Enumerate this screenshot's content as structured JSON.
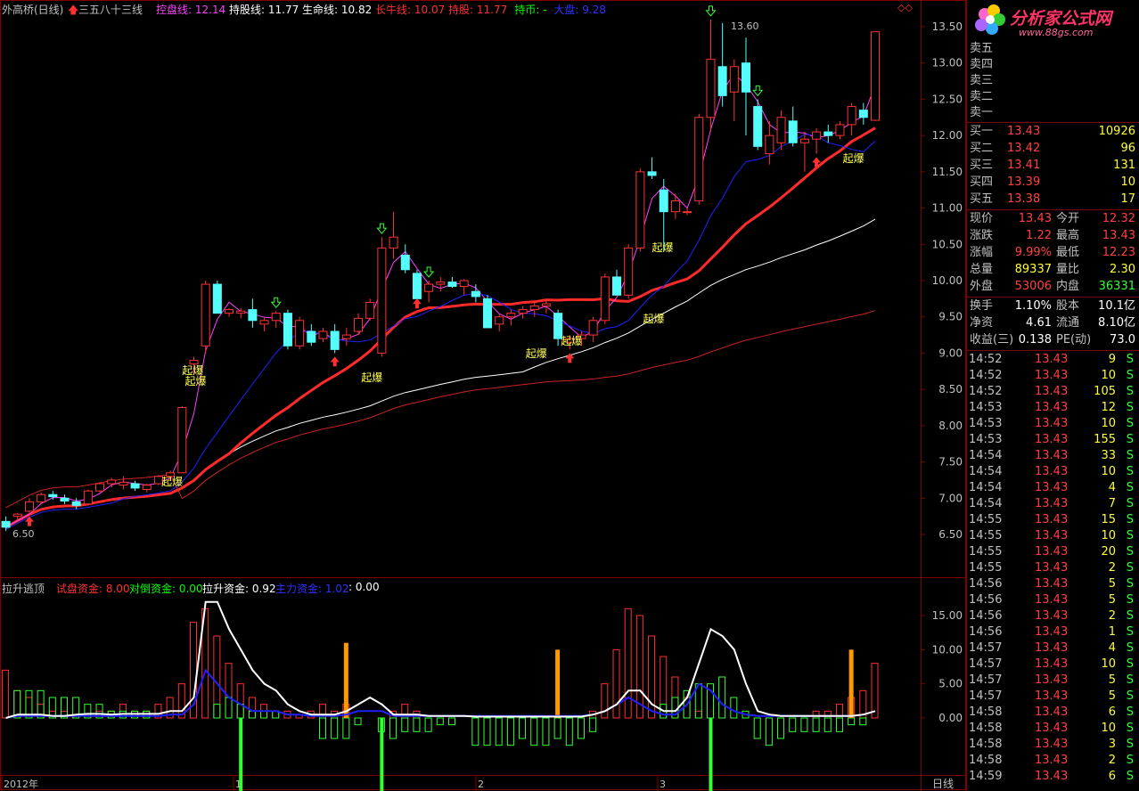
{
  "header": {
    "stock": "外高桥(日线)",
    "formula": "三五八十三线",
    "indicators": [
      {
        "label": "控盘线: 12.14",
        "color": "#ff40ff"
      },
      {
        "label": "持股线: 11.77",
        "color": "#ffffff"
      },
      {
        "label": "生命线: 10.82",
        "color": "#ffffff"
      },
      {
        "label": "长牛线: 10.07",
        "color": "#ff3030"
      },
      {
        "label": "持股: 11.77",
        "color": "#ff3030"
      },
      {
        "label": "持币: -",
        "color": "#00ff00"
      },
      {
        "label": "大盘: 9.28",
        "color": "#3030ff"
      }
    ]
  },
  "sub_header": {
    "title": "拉升逃顶",
    "indicators": [
      {
        "label": "试盘资金: 8.00",
        "color": "#ff3030"
      },
      {
        "label": "对倒资金: 0.00",
        "color": "#00ff00"
      },
      {
        "label": "拉升资金: 0.92",
        "color": "#ffffff"
      },
      {
        "label": "主力资金: 1.02",
        "color": "#3030ff"
      },
      {
        "label": ": 0.00",
        "color": "#ffffff"
      }
    ]
  },
  "logo": {
    "name": "分析家公式网",
    "url_text": "www.88gs.com"
  },
  "price_axis": [
    "13.50",
    "13.00",
    "12.50",
    "12.00",
    "11.50",
    "11.00",
    "10.50",
    "10.00",
    "9.50",
    "9.00",
    "8.50",
    "8.00",
    "7.50",
    "7.00",
    "6.50"
  ],
  "sub_axis": [
    "15.00",
    "10.00",
    "5.00",
    "0.00"
  ],
  "time_axis": [
    "2012年",
    "1",
    "2",
    "3"
  ],
  "period_label": "日线",
  "annotations": {
    "high": "13.60",
    "low": "6.50",
    "signal": "起爆"
  },
  "quote": {
    "sell": [
      {
        "label": "卖五",
        "price": "",
        "vol": ""
      },
      {
        "label": "卖四",
        "price": "",
        "vol": ""
      },
      {
        "label": "卖三",
        "price": "",
        "vol": ""
      },
      {
        "label": "卖二",
        "price": "",
        "vol": ""
      },
      {
        "label": "卖一",
        "price": "",
        "vol": ""
      }
    ],
    "buy": [
      {
        "label": "买一",
        "price": "13.43",
        "vol": "10926"
      },
      {
        "label": "买二",
        "price": "13.42",
        "vol": "96"
      },
      {
        "label": "买三",
        "price": "13.41",
        "vol": "131"
      },
      {
        "label": "买四",
        "price": "13.39",
        "vol": "10"
      },
      {
        "label": "买五",
        "price": "13.38",
        "vol": "17"
      }
    ],
    "stats1": [
      [
        "现价",
        "13.43",
        "今开",
        "12.32"
      ],
      [
        "涨跌",
        "1.22",
        "最高",
        "13.43"
      ],
      [
        "涨幅",
        "9.99%",
        "最低",
        "12.23"
      ],
      [
        "总量",
        "89337",
        "量比",
        "2.30"
      ],
      [
        "外盘",
        "53006",
        "内盘",
        "36331"
      ]
    ],
    "stats2": [
      [
        "换手",
        "1.10%",
        "股本",
        "10.1亿"
      ],
      [
        "净资",
        "4.61",
        "流通",
        "8.10亿"
      ],
      [
        "收益(三)",
        "0.138",
        "PE(动)",
        "73.0"
      ]
    ],
    "ticks": [
      [
        "14:52",
        "13.43",
        "9",
        "S"
      ],
      [
        "14:52",
        "13.43",
        "10",
        "S"
      ],
      [
        "14:52",
        "13.43",
        "105",
        "S"
      ],
      [
        "14:53",
        "13.43",
        "12",
        "S"
      ],
      [
        "14:53",
        "13.43",
        "10",
        "S"
      ],
      [
        "14:53",
        "13.43",
        "155",
        "S"
      ],
      [
        "14:54",
        "13.43",
        "33",
        "S"
      ],
      [
        "14:54",
        "13.43",
        "10",
        "S"
      ],
      [
        "14:54",
        "13.43",
        "4",
        "S"
      ],
      [
        "14:54",
        "13.43",
        "7",
        "S"
      ],
      [
        "14:55",
        "13.43",
        "15",
        "S"
      ],
      [
        "14:55",
        "13.43",
        "10",
        "S"
      ],
      [
        "14:55",
        "13.43",
        "20",
        "S"
      ],
      [
        "14:55",
        "13.43",
        "2",
        "S"
      ],
      [
        "14:56",
        "13.43",
        "5",
        "S"
      ],
      [
        "14:56",
        "13.43",
        "5",
        "S"
      ],
      [
        "14:56",
        "13.43",
        "2",
        "S"
      ],
      [
        "14:56",
        "13.43",
        "1",
        "S"
      ],
      [
        "14:57",
        "13.43",
        "4",
        "S"
      ],
      [
        "14:57",
        "13.43",
        "10",
        "S"
      ],
      [
        "14:57",
        "13.43",
        "5",
        "S"
      ],
      [
        "14:57",
        "13.43",
        "5",
        "S"
      ],
      [
        "14:58",
        "13.43",
        "6",
        "S"
      ],
      [
        "14:58",
        "13.43",
        "10",
        "S"
      ],
      [
        "14:58",
        "13.43",
        "3",
        "S"
      ],
      [
        "14:58",
        "13.43",
        "2",
        "S"
      ],
      [
        "14:59",
        "13.43",
        "6",
        "S"
      ]
    ]
  },
  "colors": {
    "up": "#ff3232",
    "down": "#54fcfc",
    "grid": "#800000"
  },
  "chart_data": {
    "type": "candlestick",
    "candles": [
      [
        6.68,
        6.75,
        6.55,
        6.6
      ],
      [
        6.75,
        6.8,
        6.7,
        6.78
      ],
      [
        6.82,
        7.0,
        6.8,
        6.95
      ],
      [
        6.95,
        7.08,
        6.92,
        7.05
      ],
      [
        7.05,
        7.1,
        6.98,
        7.02
      ],
      [
        7.0,
        7.05,
        6.92,
        6.96
      ],
      [
        6.95,
        7.0,
        6.85,
        6.9
      ],
      [
        6.92,
        7.12,
        6.9,
        7.1
      ],
      [
        7.1,
        7.22,
        7.08,
        7.2
      ],
      [
        7.2,
        7.28,
        7.15,
        7.25
      ],
      [
        7.18,
        7.3,
        7.12,
        7.22
      ],
      [
        7.2,
        7.24,
        7.1,
        7.14
      ],
      [
        7.12,
        7.2,
        7.08,
        7.18
      ],
      [
        7.2,
        7.32,
        7.18,
        7.3
      ],
      [
        7.3,
        7.38,
        7.25,
        7.35
      ],
      [
        7.35,
        8.27,
        7.35,
        8.25
      ],
      [
        8.85,
        8.95,
        8.7,
        8.9
      ],
      [
        9.1,
        10.0,
        9.0,
        9.95
      ],
      [
        9.95,
        10.0,
        9.75,
        9.55
      ],
      [
        9.55,
        9.62,
        9.5,
        9.6
      ],
      [
        9.55,
        9.62,
        9.48,
        9.58
      ],
      [
        9.6,
        9.75,
        9.35,
        9.45
      ],
      [
        9.4,
        9.5,
        9.3,
        9.45
      ],
      [
        9.45,
        9.58,
        9.35,
        9.55
      ],
      [
        9.55,
        9.6,
        9.05,
        9.1
      ],
      [
        9.1,
        9.5,
        9.05,
        9.45
      ],
      [
        9.3,
        9.4,
        9.1,
        9.15
      ],
      [
        9.2,
        9.35,
        9.15,
        9.3
      ],
      [
        9.3,
        9.4,
        9.0,
        9.05
      ],
      [
        9.2,
        9.35,
        9.1,
        9.25
      ],
      [
        9.3,
        9.55,
        9.25,
        9.48
      ],
      [
        9.48,
        9.75,
        9.45,
        9.7
      ],
      [
        9.0,
        10.6,
        8.95,
        10.45
      ],
      [
        10.45,
        10.95,
        10.3,
        10.6
      ],
      [
        10.35,
        10.5,
        10.1,
        10.15
      ],
      [
        10.1,
        10.15,
        9.8,
        9.75
      ],
      [
        9.85,
        10.0,
        9.7,
        9.95
      ],
      [
        9.95,
        10.05,
        9.85,
        9.98
      ],
      [
        9.98,
        10.05,
        9.9,
        9.92
      ],
      [
        9.92,
        10.02,
        9.8,
        10.0
      ],
      [
        9.85,
        9.95,
        9.7,
        9.78
      ],
      [
        9.75,
        9.8,
        9.35,
        9.35
      ],
      [
        9.4,
        9.55,
        9.3,
        9.5
      ],
      [
        9.5,
        9.6,
        9.38,
        9.55
      ],
      [
        9.55,
        9.65,
        9.48,
        9.6
      ],
      [
        9.6,
        9.7,
        9.5,
        9.65
      ],
      [
        9.65,
        9.72,
        9.55,
        9.68
      ],
      [
        9.55,
        9.6,
        9.1,
        9.2
      ],
      [
        9.15,
        9.25,
        9.05,
        9.2
      ],
      [
        9.2,
        9.3,
        9.1,
        9.25
      ],
      [
        9.25,
        9.5,
        9.15,
        9.45
      ],
      [
        9.45,
        10.1,
        9.4,
        10.05
      ],
      [
        10.05,
        10.15,
        9.8,
        9.8
      ],
      [
        9.8,
        10.5,
        9.75,
        10.45
      ],
      [
        10.45,
        11.55,
        10.4,
        11.5
      ],
      [
        11.5,
        11.7,
        11.4,
        11.45
      ],
      [
        11.25,
        11.4,
        10.4,
        10.95
      ],
      [
        10.95,
        11.2,
        10.85,
        11.1
      ],
      [
        10.95,
        11.0,
        10.9,
        10.95
      ],
      [
        11.1,
        12.3,
        11.05,
        12.25
      ],
      [
        12.25,
        13.6,
        12.05,
        13.05
      ],
      [
        12.95,
        13.55,
        12.4,
        12.55
      ],
      [
        12.6,
        13.05,
        12.2,
        12.95
      ],
      [
        13.0,
        13.35,
        12.0,
        12.6
      ],
      [
        12.4,
        12.5,
        11.8,
        11.85
      ],
      [
        11.75,
        12.2,
        11.6,
        12.0
      ],
      [
        11.9,
        12.35,
        11.8,
        12.25
      ],
      [
        12.2,
        12.4,
        11.85,
        11.9
      ],
      [
        11.9,
        12.05,
        11.5,
        11.95
      ],
      [
        11.95,
        12.1,
        11.75,
        12.05
      ],
      [
        12.05,
        12.15,
        11.9,
        12.0
      ],
      [
        12.0,
        12.2,
        11.95,
        12.15
      ],
      [
        12.15,
        12.45,
        12.0,
        12.4
      ],
      [
        12.35,
        12.45,
        12.15,
        12.25
      ],
      [
        12.21,
        13.43,
        12.2,
        13.43
      ]
    ],
    "xrange": [
      0,
      75
    ],
    "ylim": [
      6.3,
      13.7
    ],
    "sub_ylim": [
      -4,
      19
    ]
  }
}
